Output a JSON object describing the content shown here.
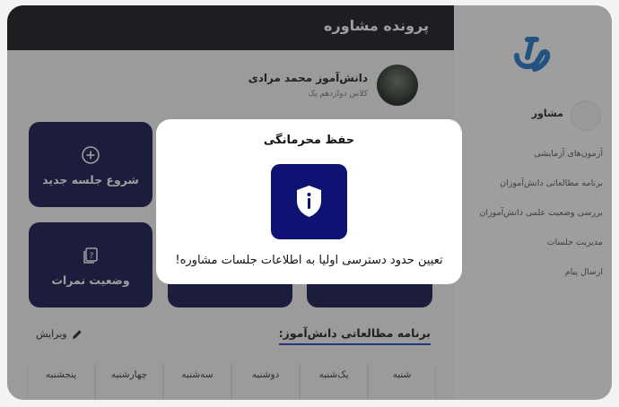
{
  "header": {
    "title": "پرونده مشاوره"
  },
  "student": {
    "name": "دانش‌آموز محمد مرادی",
    "grade": "کلاس دوازدهم یک"
  },
  "cards": [
    {
      "label": "شروع جلسه جدید",
      "icon": "plus-circle-icon"
    },
    {
      "label": "وضعیت نمرات",
      "icon": "question-document-icon"
    }
  ],
  "study_program": {
    "title": "برنامه مطالعاتی دانش‌آموز:",
    "edit_label": "ویرایش"
  },
  "days": [
    "شنبه",
    "یک‌شنبه",
    "دوشنبه",
    "سه‌شنبه",
    "چهارشنبه",
    "پنجشنبه"
  ],
  "sidebar": {
    "counselor_label": "مشاور",
    "items": [
      {
        "label": "آزمون‌های آزمایشی"
      },
      {
        "label": "برنامه مطالعاتی دانش‌آموزان"
      },
      {
        "label": "بررسی وضعیت علمی دانش‌آموزان"
      },
      {
        "label": "مدیریت جلسات"
      },
      {
        "label": "ارسال پیام"
      }
    ]
  },
  "modal": {
    "title": "حفظ محرمانگی",
    "text": "تعیین حدود دسترسی اولیا به اطلاعات جلسات مشاوره!",
    "icon": "shield-info-icon"
  },
  "colors": {
    "accent": "#0d1273",
    "card": "#13134d",
    "topbar": "#14141e",
    "logo": "#1f77c9"
  }
}
